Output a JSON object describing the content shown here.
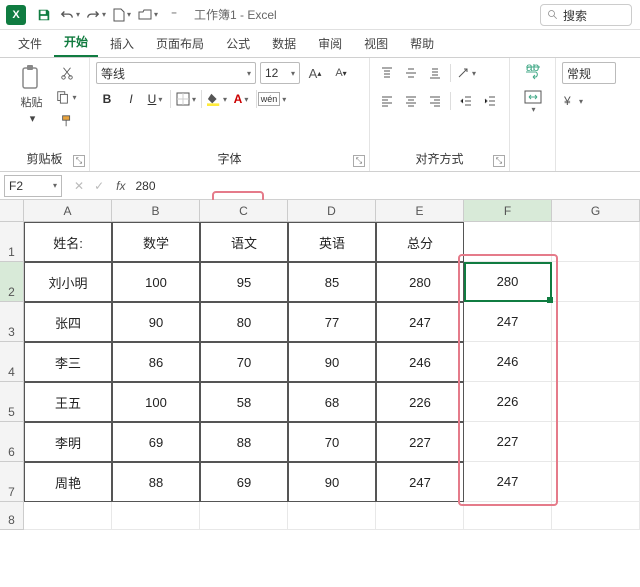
{
  "app": {
    "title": "工作簿1 - Excel"
  },
  "search": {
    "placeholder": "搜索"
  },
  "tabs": {
    "file": "文件",
    "home": "开始",
    "insert": "插入",
    "layout": "页面布局",
    "formula": "公式",
    "data": "数据",
    "review": "审阅",
    "view": "视图",
    "help": "帮助"
  },
  "ribbon": {
    "clipboard": {
      "paste": "粘贴",
      "label": "剪贴板"
    },
    "font": {
      "name": "等线",
      "size": "12",
      "label": "字体"
    },
    "align": {
      "label": "对齐方式"
    },
    "wrap": {
      "label": "自动换行"
    },
    "number": {
      "format": "常规"
    }
  },
  "namebox": "F2",
  "formula_value": "280",
  "columns": [
    "A",
    "B",
    "C",
    "D",
    "E",
    "F",
    "G"
  ],
  "rows": [
    "1",
    "2",
    "3",
    "4",
    "5",
    "6",
    "7",
    "8"
  ],
  "chart_data": {
    "type": "table",
    "headers": [
      "姓名:",
      "数学",
      "语文",
      "英语",
      "总分"
    ],
    "extra_col_header": "",
    "rows": [
      {
        "name": "刘小明",
        "math": 100,
        "chinese": 95,
        "english": 85,
        "total": 280,
        "f": 280
      },
      {
        "name": "张四",
        "math": 90,
        "chinese": 80,
        "english": 77,
        "total": 247,
        "f": 247
      },
      {
        "name": "李三",
        "math": 86,
        "chinese": 70,
        "english": 90,
        "total": 246,
        "f": 246
      },
      {
        "name": "王五",
        "math": 100,
        "chinese": 58,
        "english": 68,
        "total": 226,
        "f": 226
      },
      {
        "name": "李明",
        "math": 69,
        "chinese": 88,
        "english": 70,
        "total": 227,
        "f": 227
      },
      {
        "name": "周艳",
        "math": 88,
        "chinese": 69,
        "english": 90,
        "total": 247,
        "f": 247
      }
    ]
  }
}
